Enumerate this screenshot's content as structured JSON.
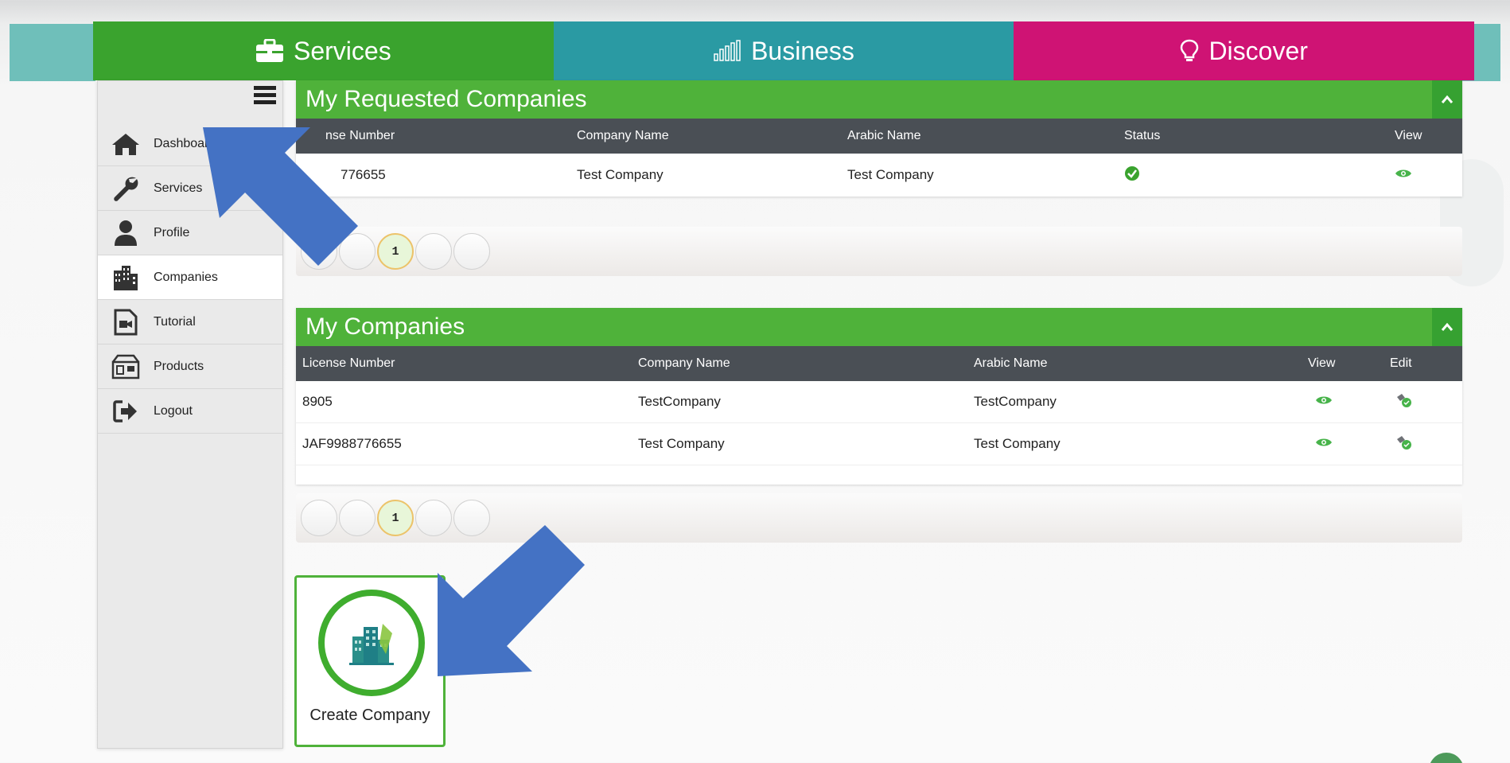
{
  "nav": {
    "services": "Services",
    "business": "Business",
    "discover": "Discover"
  },
  "sidebar": {
    "items": [
      {
        "label": "Dashboard",
        "icon": "home-icon"
      },
      {
        "label": "Services",
        "icon": "wrench-icon"
      },
      {
        "label": "Profile",
        "icon": "user-icon"
      },
      {
        "label": "Companies",
        "icon": "building-icon"
      },
      {
        "label": "Tutorial",
        "icon": "video-file-icon"
      },
      {
        "label": "Products",
        "icon": "products-icon"
      },
      {
        "label": "Logout",
        "icon": "logout-icon"
      }
    ],
    "active": "Companies"
  },
  "requested": {
    "title": "My Requested Companies",
    "columns": [
      "License Number",
      "Company Name",
      "Arabic Name",
      "Status",
      "View"
    ],
    "visible_header_license": "nse Number",
    "rows": [
      {
        "license": "776655",
        "company": "Test Company",
        "arabic": "Test Company",
        "status": "approved-check-icon",
        "view": "eye-icon"
      }
    ],
    "page": "1"
  },
  "companies": {
    "title": "My Companies",
    "columns": [
      "License Number",
      "Company Name",
      "Arabic Name",
      "View",
      "Edit"
    ],
    "rows": [
      {
        "license": "8905",
        "company": "TestCompany",
        "arabic": "TestCompany"
      },
      {
        "license": "JAF9988776655",
        "company": "Test Company",
        "arabic": "Test Company"
      }
    ],
    "page": "1"
  },
  "create": {
    "label": "Create Company"
  },
  "colors": {
    "green": "#4fb23a",
    "teal": "#2a9aa3",
    "magenta": "#cf1374",
    "header_dark": "#4a4f55",
    "arrow_blue": "#4472c4"
  }
}
